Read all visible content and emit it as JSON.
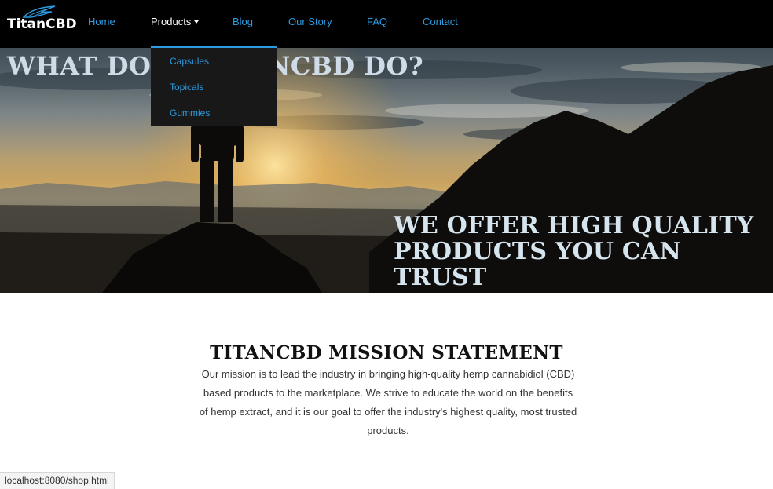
{
  "brand": {
    "name": "TitanCBD",
    "logo_icon": "wing-icon"
  },
  "nav": {
    "home": "Home",
    "products": "Products",
    "blog": "Blog",
    "our_story": "Our Story",
    "faq": "FAQ",
    "contact": "Contact",
    "active": "Products"
  },
  "dropdown": {
    "items": [
      "Capsules",
      "Topicals",
      "Gummies"
    ]
  },
  "hero": {
    "heading": "WHAT DOES TITANCBD DO?",
    "tagline_line1": "WE OFFER HIGH QUALITY",
    "tagline_line2": "PRODUCTS YOU CAN TRUST"
  },
  "mission": {
    "title": "TITANCBD MISSION STATEMENT",
    "body": "Our mission is to lead the industry in bringing high-quality hemp cannabidiol (CBD) based products to the marketplace. We strive to educate the world on the benefits of hemp extract, and it is our goal to offer the industry's highest quality, most trusted products."
  },
  "status_url": "localhost:8080/shop.html",
  "colors": {
    "accent": "#2c9be0",
    "nav_bg": "#000000",
    "dropdown_bg": "#181818",
    "hero_text": "#d6e4ee"
  }
}
